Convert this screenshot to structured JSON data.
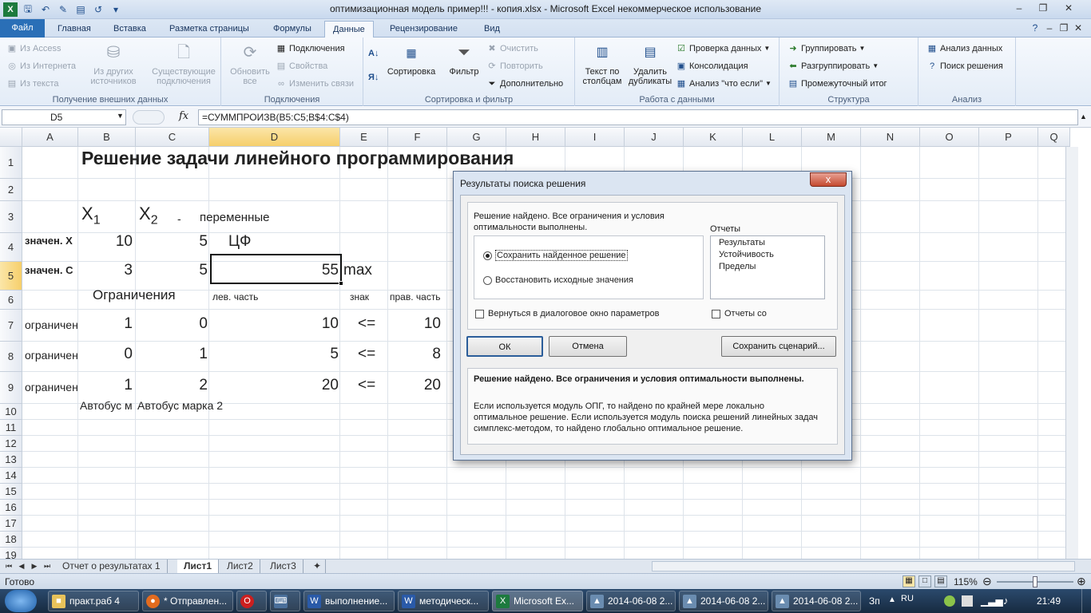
{
  "window": {
    "title": "оптимизационная модель пример!!! - копия.xlsx  -  Microsoft Excel некоммерческое использование"
  },
  "ribbon": {
    "tabs": [
      "Файл",
      "Главная",
      "Вставка",
      "Разметка страницы",
      "Формулы",
      "Данные",
      "Рецензирование",
      "Вид"
    ],
    "active_tab": "Данные",
    "groups": {
      "external": {
        "label": "Получение внешних данных",
        "from_access": "Из Access",
        "from_web": "Из Интернета",
        "from_text": "Из текста",
        "other_sources": "Из других источников",
        "existing": "Существующие подключения"
      },
      "connections": {
        "label": "Подключения",
        "refresh_all": "Обновить все",
        "connections": "Подключения",
        "properties": "Свойства",
        "edit_links": "Изменить связи"
      },
      "sort_filter": {
        "label": "Сортировка и фильтр",
        "sort": "Сортировка",
        "filter": "Фильтр",
        "clear": "Очистить",
        "reapply": "Повторить",
        "advanced": "Дополнительно"
      },
      "data_tools": {
        "label": "Работа с данными",
        "text_to_columns": "Текст по столбцам",
        "remove_duplicates": "Удалить дубликаты",
        "validation": "Проверка данных",
        "consolidate": "Консолидация",
        "what_if": "Анализ \"что если\""
      },
      "outline": {
        "label": "Структура",
        "group": "Группировать",
        "ungroup": "Разгруппировать",
        "subtotal": "Промежуточный итог"
      },
      "analysis": {
        "label": "Анализ",
        "data_analysis": "Анализ данных",
        "solver": "Поиск решения"
      }
    }
  },
  "formula_bar": {
    "name_box": "D5",
    "fx": "fx",
    "formula": "=СУММПРОИЗВ(B5:C5;B$4:C$4)"
  },
  "grid": {
    "columns": [
      "A",
      "B",
      "C",
      "D",
      "E",
      "F",
      "G",
      "H",
      "I",
      "J",
      "K",
      "L",
      "M",
      "N",
      "O",
      "P",
      "Q"
    ],
    "rows": [
      "1",
      "2",
      "3",
      "4",
      "5",
      "6",
      "7",
      "8",
      "9",
      "10",
      "11",
      "12",
      "13",
      "14",
      "15",
      "16",
      "17",
      "18",
      "19"
    ],
    "selected_col": "D",
    "selected_row": "5",
    "cells": {
      "title": "Решение задачи линейного программирования",
      "x1_letter": "X",
      "x1_sub": "1",
      "x2_letter": "X",
      "x2_sub": "2",
      "dash": "-",
      "variables": "переменные",
      "a4": "значен. Х",
      "b4": "10",
      "c4": "5",
      "d4": "ЦФ",
      "a5": "значен. С",
      "b5": "3",
      "c5": "5",
      "d5": "55",
      "e5": "max",
      "b6": "Ограничения",
      "d6": "лев. часть",
      "e6": "знак",
      "f6": "прав. часть",
      "a7": "ограничен",
      "b7": "1",
      "c7": "0",
      "d7": "10",
      "e7": "<=",
      "f7": "10",
      "a8": "ограничен",
      "b8": "0",
      "c8": "1",
      "d8": "5",
      "e8": "<=",
      "f8": "8",
      "a9": "ограничен",
      "b9": "1",
      "c9": "2",
      "d9": "20",
      "e9": "<=",
      "f9": "20",
      "b10": "Автобус м",
      "c10": "Автобус марка 2"
    }
  },
  "sheets": {
    "tabs": [
      "Отчет о результатах 1",
      "Лист1",
      "Лист2",
      "Лист3"
    ],
    "active": "Лист1"
  },
  "status": {
    "ready": "Готово",
    "zoom": "115%"
  },
  "dialog": {
    "title": "Результаты поиска решения",
    "close": "x",
    "message_line1": "Решение найдено. Все ограничения и условия",
    "message_line2": "оптимальности выполнены.",
    "keep_solution": "Сохранить найденное решение",
    "restore_values": "Восстановить исходные значения",
    "reports_label": "Отчеты",
    "reports": [
      "Результаты",
      "Устойчивость",
      "Пределы"
    ],
    "return_dialog": "Вернуться в диалоговое окно параметров",
    "outline_reports": "Отчеты со",
    "ok": "ОК",
    "cancel": "Отмена",
    "save_scenario": "Сохранить сценарий...",
    "summary_bold": "Решение найдено. Все ограничения и условия оптимальности выполнены.",
    "summary_line1": "Если используется модуль ОПГ, то найдено по крайней мере локально",
    "summary_line2": "оптимальное решение. Если используется модуль поиска решений линейных задач",
    "summary_line3": "симплекс-методом, то найдено глобально оптимальное решение."
  },
  "taskbar": {
    "items": [
      "практ.раб 4",
      "* Отправлен...",
      "",
      "",
      "выполнение...",
      "методическ...",
      "Microsoft Ex...",
      "2014-06-08 2...",
      "2014-06-08 2...",
      "2014-06-08 2..."
    ],
    "lang_short": "Зп",
    "lang": "RU",
    "time": "21:49"
  }
}
